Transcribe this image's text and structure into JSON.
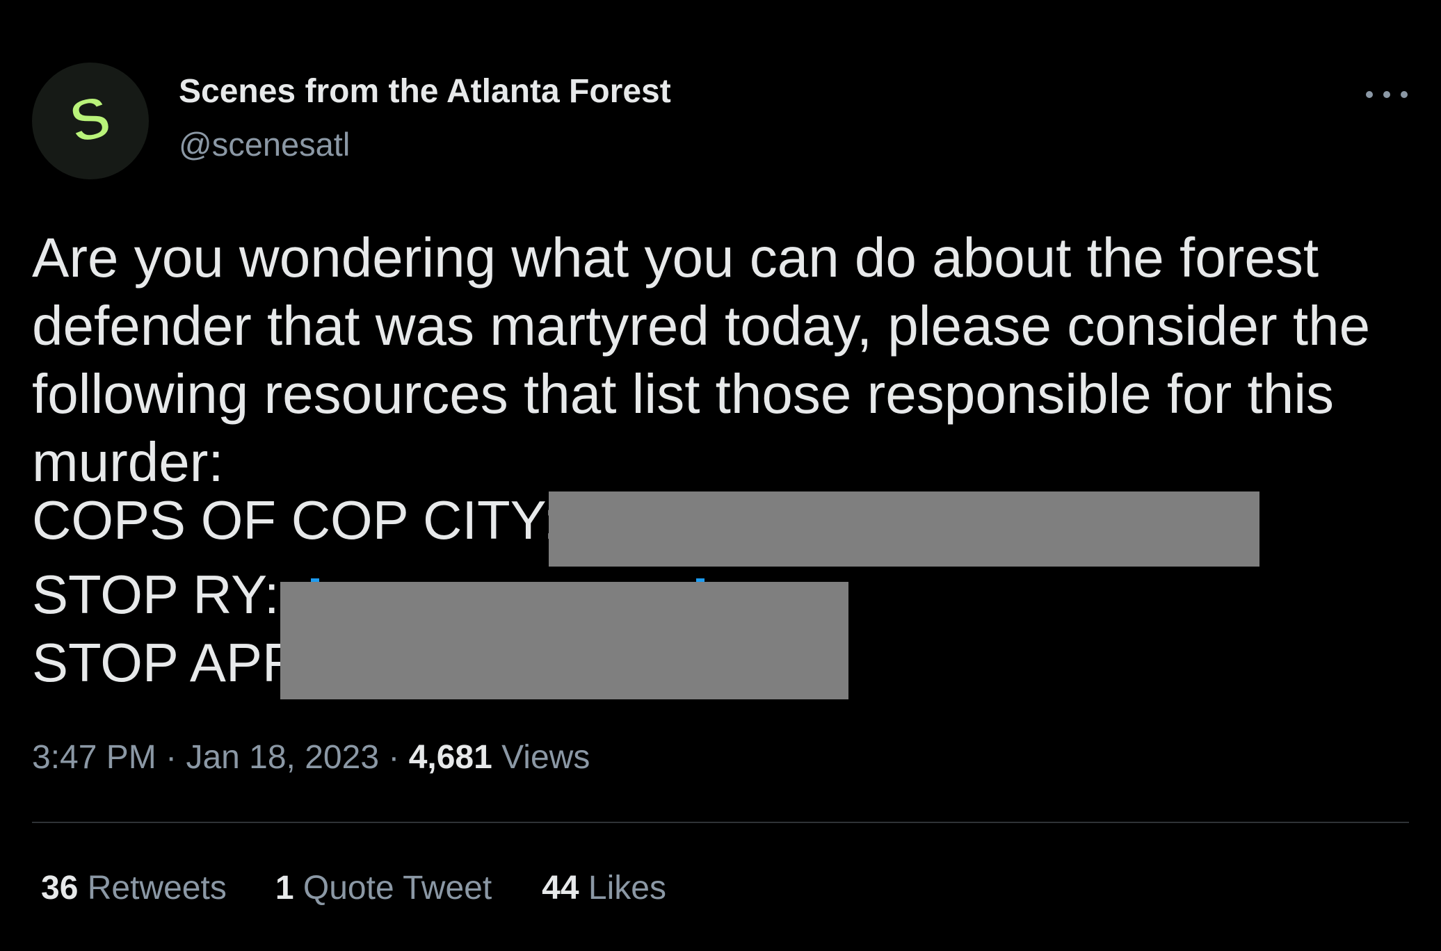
{
  "author": {
    "display_name": "Scenes from the Atlanta Forest",
    "handle": "@scenesatl",
    "avatar_letter": "S",
    "avatar_color": "#b9f37a",
    "avatar_bg": "#161a16"
  },
  "tweet": {
    "text": "Are you wondering what you can do about the forest defender that was martyred today, please consider the following resources that list those responsible for this murder:",
    "lines": [
      {
        "label": "COPS OF COP CITY:"
      },
      {
        "label": "STOP RY:"
      },
      {
        "label": "STOP APF"
      }
    ]
  },
  "meta": {
    "time": "3:47 PM",
    "sep1": "·",
    "date": "Jan 18, 2023",
    "sep2": "·",
    "views_count": "4,681",
    "views_label": "Views"
  },
  "stats": {
    "retweets_count": "36",
    "retweets_label": "Retweets",
    "quotes_count": "1",
    "quotes_label": "Quote Tweet",
    "likes_count": "44",
    "likes_label": "Likes"
  },
  "icons": {
    "more": "more-horizontal-icon"
  },
  "colors": {
    "background": "#000000",
    "primary_text": "#e7e9ea",
    "secondary_text": "#8b98a5",
    "link": "#1d9bf0",
    "redaction": "#7f7f7f",
    "divider": "#2f3336"
  }
}
